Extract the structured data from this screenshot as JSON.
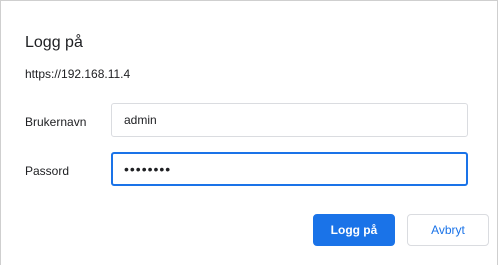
{
  "dialog": {
    "title": "Logg på",
    "origin": "https://192.168.11.4",
    "username": {
      "label": "Brukernavn",
      "value": "admin"
    },
    "password": {
      "label": "Passord",
      "value": "••••••••"
    },
    "buttons": {
      "sign_in": "Logg på",
      "cancel": "Avbryt"
    }
  },
  "colors": {
    "accent": "#1a73e8",
    "border": "#dadce0",
    "text": "#202124"
  }
}
